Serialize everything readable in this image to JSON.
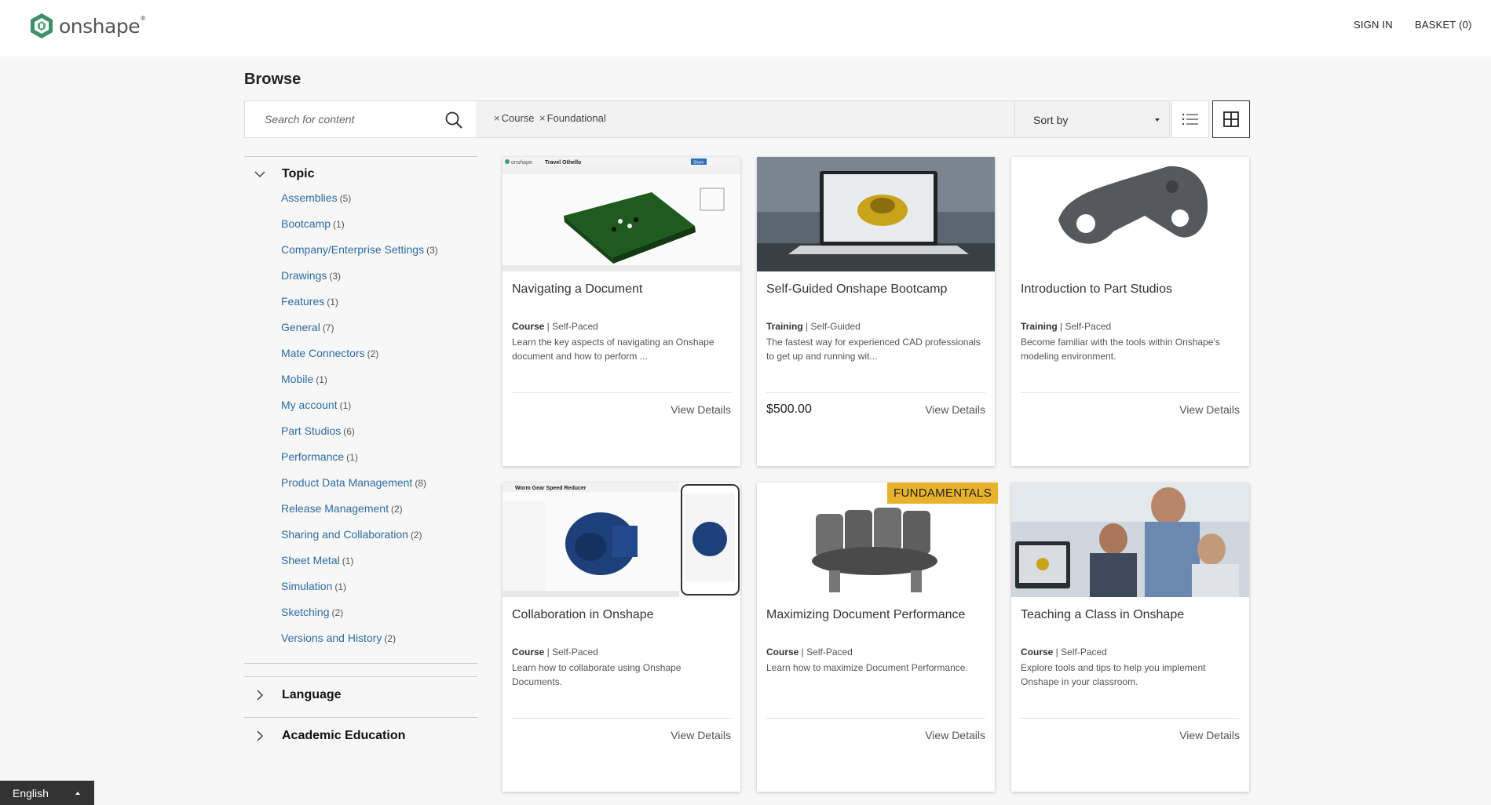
{
  "header": {
    "logo_text": "onshape",
    "sign_in": "SIGN IN",
    "basket": "BASKET (0)"
  },
  "page": {
    "title": "Browse"
  },
  "search": {
    "placeholder": "Search for content"
  },
  "filters": {
    "active": [
      "Course",
      "Foundational"
    ],
    "remove_icon": "×"
  },
  "sort": {
    "label": "Sort by"
  },
  "view_modes": [
    "list-view",
    "grid-view"
  ],
  "sidebar": {
    "topic": {
      "title": "Topic",
      "items": [
        {
          "label": "Assemblies",
          "count": "(5)"
        },
        {
          "label": "Bootcamp",
          "count": "(1)"
        },
        {
          "label": "Company/Enterprise Settings",
          "count": "(3)"
        },
        {
          "label": "Drawings",
          "count": "(3)"
        },
        {
          "label": "Features",
          "count": "(1)"
        },
        {
          "label": "General",
          "count": "(7)"
        },
        {
          "label": "Mate Connectors",
          "count": "(2)"
        },
        {
          "label": "Mobile",
          "count": "(1)"
        },
        {
          "label": "My account",
          "count": "(1)"
        },
        {
          "label": "Part Studios",
          "count": "(6)"
        },
        {
          "label": "Performance",
          "count": "(1)"
        },
        {
          "label": "Product Data Management",
          "count": "(8)"
        },
        {
          "label": "Release Management",
          "count": "(2)"
        },
        {
          "label": "Sharing and Collaboration",
          "count": "(2)"
        },
        {
          "label": "Sheet Metal",
          "count": "(1)"
        },
        {
          "label": "Simulation",
          "count": "(1)"
        },
        {
          "label": "Sketching",
          "count": "(2)"
        },
        {
          "label": "Versions and History",
          "count": "(2)"
        }
      ]
    },
    "language": {
      "title": "Language"
    },
    "academic": {
      "title": "Academic Education"
    }
  },
  "cards": [
    {
      "title": "Navigating a Document",
      "type": "Course",
      "pace": "Self-Paced",
      "desc": "Learn the key aspects of navigating an Onshape document and how to perform ...",
      "price": "",
      "cta": "View Details",
      "badge": ""
    },
    {
      "title": "Self-Guided Onshape Bootcamp",
      "type": "Training",
      "pace": "Self-Guided",
      "desc": "The fastest way for experienced CAD professionals to get up and running wit...",
      "price": "$500.00",
      "cta": "View Details",
      "badge": ""
    },
    {
      "title": "Introduction to Part Studios",
      "type": "Training",
      "pace": "Self-Paced",
      "desc": "Become familiar with the tools within Onshape's modeling environment.",
      "price": "",
      "cta": "View Details",
      "badge": ""
    },
    {
      "title": "Collaboration in Onshape",
      "type": "Course",
      "pace": "Self-Paced",
      "desc": "Learn how to collaborate using Onshape Documents.",
      "price": "",
      "cta": "View Details",
      "badge": ""
    },
    {
      "title": "Maximizing Document Performance",
      "type": "Course",
      "pace": "Self-Paced",
      "desc": "Learn how to maximize Document Performance.",
      "price": "",
      "cta": "View Details",
      "badge": "FUNDAMENTALS"
    },
    {
      "title": "Teaching a Class in Onshape",
      "type": "Course",
      "pace": "Self-Paced",
      "desc": "Explore tools and tips to help you implement Onshape in your classroom.",
      "price": "",
      "cta": "View Details",
      "badge": ""
    }
  ],
  "card_image_screen_text": {
    "travel": "Travel Othello",
    "worm": "Worm Gear Speed Reducer",
    "onshape": "onshape",
    "share": "Share"
  },
  "language_picker": {
    "label": "English"
  },
  "colors": {
    "link": "#2d6ba3",
    "badge": "#e9b22c",
    "brand": "#4a9a6e"
  }
}
